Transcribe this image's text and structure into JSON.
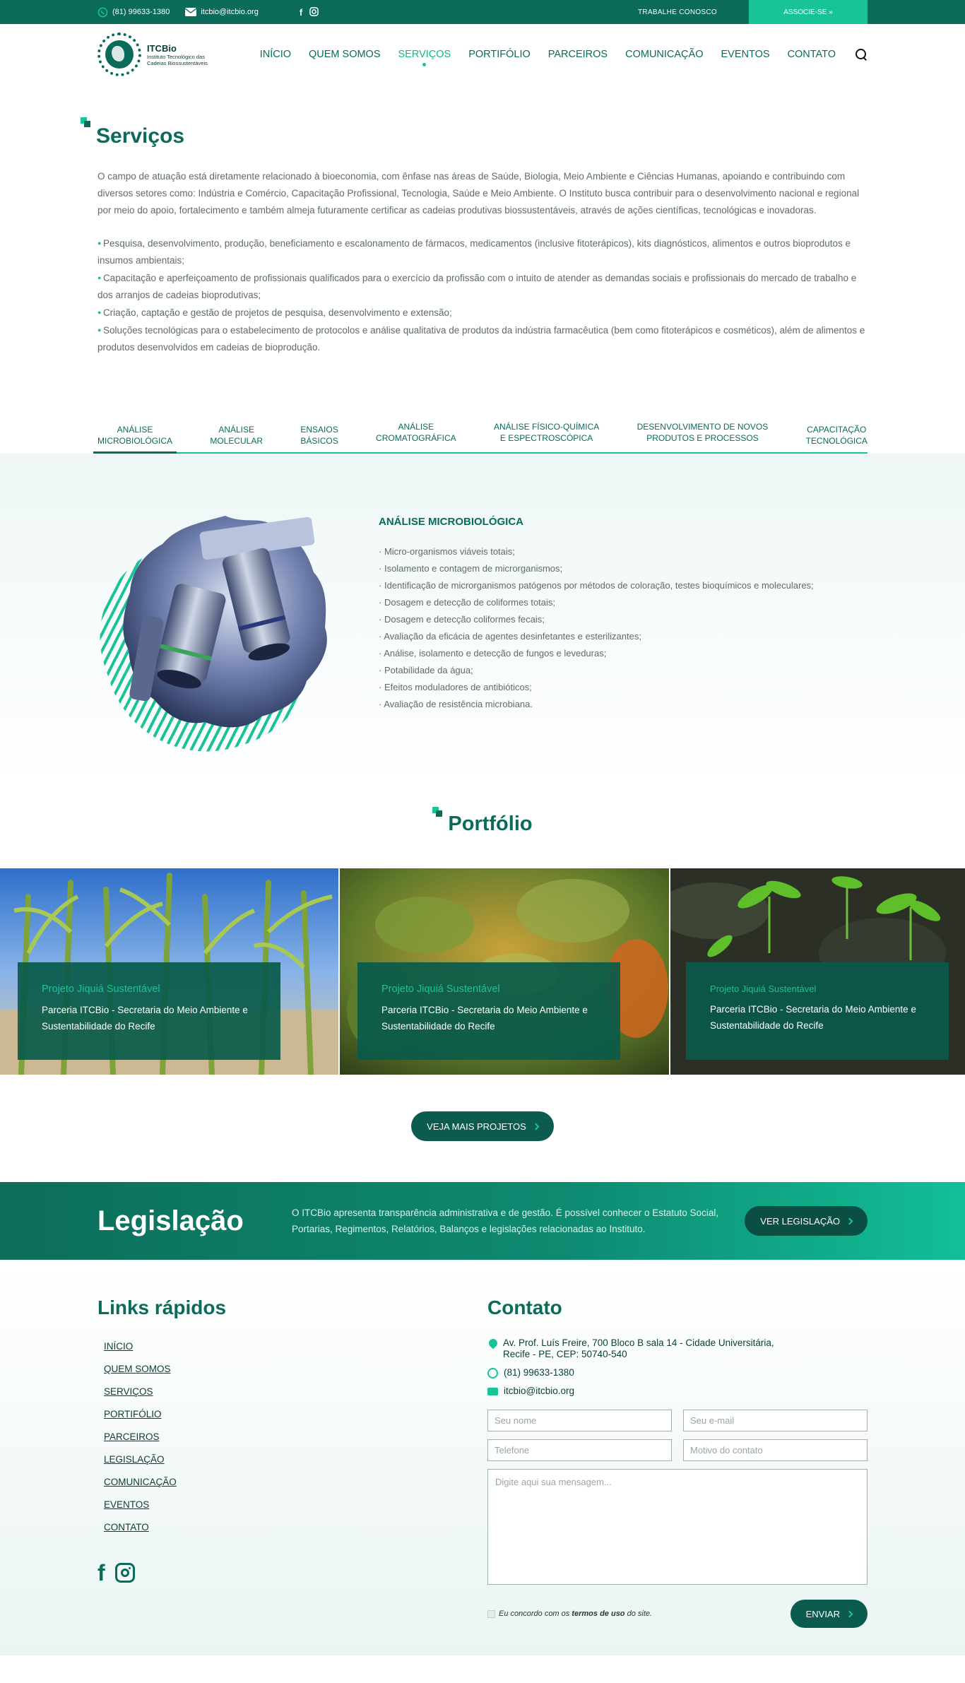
{
  "topbar": {
    "phone": "(81) 99633-1380",
    "email": "itcbio@itcbio.org",
    "social": [
      "facebook-icon",
      "instagram-icon"
    ],
    "work_with_us": "TRABALHE CONOSCO",
    "join": "ASSOCIE-SE »"
  },
  "brand": {
    "name": "ITCBio",
    "subtitle": "Instituto Tecnológico das Cadeias Biossustentáveis"
  },
  "nav": {
    "items": [
      {
        "label": "INÍCIO"
      },
      {
        "label": "QUEM SOMOS"
      },
      {
        "label": "SERVIÇOS"
      },
      {
        "label": "PORTIFÓLIO"
      },
      {
        "label": "PARCEIROS"
      },
      {
        "label": "COMUNICAÇÃO"
      },
      {
        "label": "EVENTOS"
      },
      {
        "label": "CONTATO"
      }
    ],
    "active": "SERVIÇOS"
  },
  "services": {
    "title": "Serviços",
    "intro": "O campo de atuação está diretamente relacionado à bioeconomia, com ênfase nas áreas de Saúde, Biologia, Meio Ambiente e Ciências Humanas, apoiando e contribuindo com diversos setores como: Indústria e Comércio, Capacitação Profissional, Tecnologia, Saúde e Meio Ambiente. O Instituto busca contribuir para o desenvolvimento nacional e regional por meio do apoio, fortalecimento e também almeja futuramente certificar as cadeias produtivas biossustentáveis, através de ações científicas, tecnológicas e inovadoras.",
    "bullets": [
      "Pesquisa, desenvolvimento, produção, beneficiamento e escalonamento de fármacos, medicamentos (inclusive fitoterápicos), kits diagnósticos, alimentos e outros bioprodutos e insumos ambientais;",
      "Capacitação e aperfeiçoamento de profissionais qualificados para o exercício da profissão com o intuito de atender as demandas sociais e profissionais do mercado de trabalho e dos arranjos de cadeias bioprodutivas;",
      "Criação, captação e gestão de projetos de pesquisa, desenvolvimento e extensão;",
      "Soluções tecnológicas para o estabelecimento de protocolos e análise qualitativa de produtos da indústria farmacêutica (bem como fitoterápicos e cosméticos), além de alimentos e produtos desenvolvidos em cadeias de bioprodução."
    ]
  },
  "tabs": [
    {
      "line1": "ANÁLISE",
      "line2": "MICROBIOLÓGICA"
    },
    {
      "line1": "ANÁLISE",
      "line2": "MOLECULAR"
    },
    {
      "line1": "ENSAIOS",
      "line2": "BÁSICOS"
    },
    {
      "line1": "ANÁLISE",
      "line2": "CROMATOGRÁFICA"
    },
    {
      "line1": "ANÁLISE FÍSICO-QUÍMICA",
      "line2": "E ESPECTROSCÓPICA"
    },
    {
      "line1": "DESENVOLVIMENTO DE NOVOS",
      "line2": "PRODUTOS E PROCESSOS"
    },
    {
      "line1": "CAPACITAÇÃO",
      "line2": "TECNOLÓGICA"
    }
  ],
  "analysis": {
    "title": "ANÁLISE MICROBIOLÓGICA",
    "items": [
      "Micro-organismos viáveis totais;",
      "Isolamento e contagem de microrganismos;",
      "Identificação de microrganismos patógenos por métodos de coloração, testes bioquímicos e moleculares;",
      "Dosagem e detecção de coliformes totais;",
      "Dosagem e detecção coliformes fecais;",
      "Avaliação da eficácia de agentes desinfetantes e esterilizantes;",
      "Análise, isolamento e detecção de fungos e leveduras;",
      "Potabilidade da água;",
      "Efeitos moduladores de antibióticos;",
      "Avaliação de resistência microbiana."
    ]
  },
  "portfolio": {
    "title": "Portfólio",
    "cards": [
      {
        "title": "Projeto Jiquiá Sustentável",
        "desc": "Parceria ITCBio - Secretaria do Meio Ambiente e Sustentabilidade do Recife"
      },
      {
        "title": "Projeto Jiquiá Sustentável",
        "desc": "Parceria ITCBio - Secretaria do Meio Ambiente e Sustentabilidade do Recife"
      },
      {
        "title": "Projeto Jiquiá Sustentável",
        "desc": "Parceria ITCBio - Secretaria do Meio Ambiente e Sustentabilidade do Recife"
      }
    ],
    "more_button": "VEJA MAIS PROJETOS"
  },
  "legislation": {
    "title": "Legislação",
    "text": "O ITCBio apresenta transparência administrativa e de gestão. É possível conhecer o Estatuto Social, Portarias, Regimentos, Relatórios, Balanços e legislações relacionadas ao Instituto.",
    "button": "VER LEGISLAÇÃO"
  },
  "footer": {
    "links_title": "Links rápidos",
    "links": [
      "INÍCIO",
      "QUEM SOMOS",
      "SERVIÇOS",
      "PORTIFÓLIO",
      "PARCEIROS",
      "LEGISLAÇÃO",
      "COMUNICAÇÃO",
      "EVENTOS",
      "CONTATO"
    ],
    "social": [
      "facebook-icon",
      "instagram-icon"
    ],
    "contact_title": "Contato",
    "address_line1": "Av. Prof. Luís Freire, 700 Bloco B sala 14 - Cidade Universitária,",
    "address_line2": "Recife - PE, CEP: 50740-540",
    "phone": "(81) 99633-1380",
    "email": "itcbio@itcbio.org",
    "form": {
      "name_placeholder": "Seu nome",
      "email_placeholder": "Seu e-mail",
      "phone_placeholder": "Telefone",
      "reason_placeholder": "Motivo do contato",
      "message_placeholder": "Digite aqui sua mensagem...",
      "terms_prefix": "Eu concordo com os ",
      "terms_link": "termos de uso",
      "terms_suffix": " do site.",
      "submit": "ENVIAR"
    }
  },
  "colors": {
    "primary": "#0b6b5a",
    "accent": "#19c39a",
    "dark": "#0b4e43"
  }
}
